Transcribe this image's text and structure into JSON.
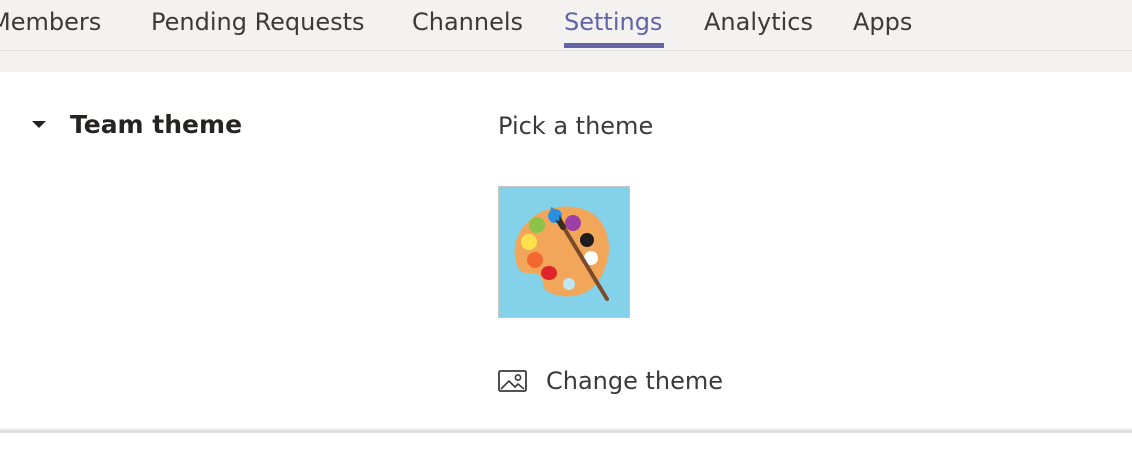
{
  "tabs": [
    {
      "label": "Members",
      "active": false
    },
    {
      "label": "Pending Requests",
      "active": false
    },
    {
      "label": "Channels",
      "active": false
    },
    {
      "label": "Settings",
      "active": true
    },
    {
      "label": "Analytics",
      "active": false
    },
    {
      "label": "Apps",
      "active": false
    }
  ],
  "section": {
    "title": "Team theme",
    "expanded": true
  },
  "theme": {
    "pick_label": "Pick a theme",
    "thumbnail_icon": "paint-palette-icon",
    "tile_color": "#84d2ea",
    "change_label": "Change theme",
    "change_icon": "image-icon"
  },
  "colors": {
    "accent": "#6264a7"
  }
}
